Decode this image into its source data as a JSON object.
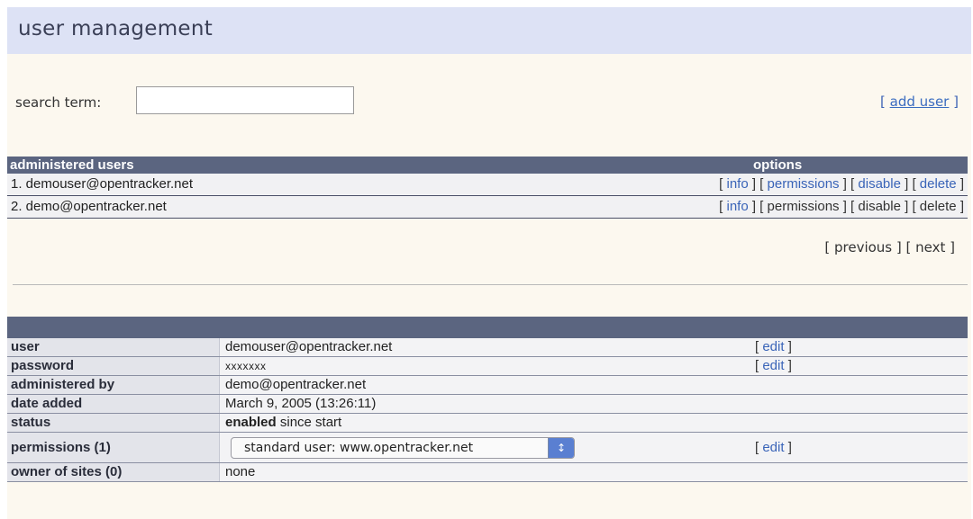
{
  "header": {
    "title": "user management"
  },
  "search": {
    "label": "search term:",
    "value": "",
    "placeholder": ""
  },
  "add_user": {
    "open": "[",
    "label": "add user",
    "close": "]"
  },
  "users_table": {
    "col_name": "administered users",
    "col_options": "options",
    "rows": [
      {
        "name": "1. demouser@opentracker.net",
        "info": "info",
        "permissions": "permissions",
        "disable": "disable",
        "delete": "delete"
      },
      {
        "name": "2. demo@opentracker.net",
        "info": "info",
        "permissions": "permissions",
        "disable": "disable",
        "delete": "delete"
      }
    ]
  },
  "pager": {
    "previous": "previous",
    "next": "next"
  },
  "details": {
    "user": {
      "label": "user",
      "value": "demouser@opentracker.net",
      "edit": "edit"
    },
    "password": {
      "label": "password",
      "value": "xxxxxxx",
      "edit": "edit"
    },
    "administered_by": {
      "label": "administered by",
      "value": "demo@opentracker.net"
    },
    "date_added": {
      "label": "date added",
      "value": "March 9, 2005 (13:26:11)"
    },
    "status": {
      "label": "status",
      "value_bold": "enabled",
      "value_rest": " since start"
    },
    "permissions": {
      "label": "permissions (1)",
      "selected": "standard user: www.opentracker.net",
      "edit": "edit"
    },
    "owner_of_sites": {
      "label": "owner of sites (0)",
      "value": "none"
    }
  },
  "colors": {
    "title_bar": "#dde2f5",
    "page_bg": "#fcf8ef",
    "table_header": "#5b6580",
    "link": "#3a64b8"
  },
  "icons": {
    "select_arrows": "updown-arrows-icon"
  }
}
